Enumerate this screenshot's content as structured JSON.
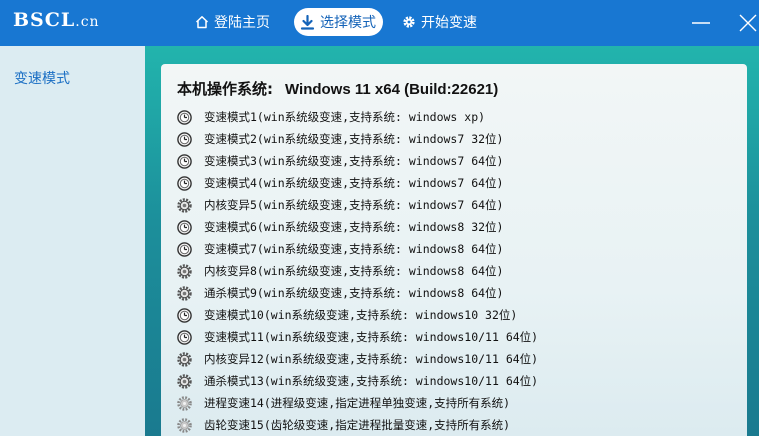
{
  "header": {
    "logo_main": "BSCL",
    "logo_domain": ".cn",
    "nav": [
      {
        "label": "登陆主页",
        "icon": "home-icon"
      },
      {
        "label": "选择模式",
        "icon": "download-arrow-icon",
        "active": true
      },
      {
        "label": "开始变速",
        "icon": "gear-icon"
      }
    ],
    "window_controls": [
      "minimize-icon",
      "close-icon"
    ]
  },
  "sidebar": {
    "items": [
      {
        "label": "变速模式"
      }
    ]
  },
  "main": {
    "os_label": "本机操作系统:",
    "os_value": "Windows 11 x64 (Build:22621)",
    "modes": [
      {
        "icon": "clock-radio-icon",
        "label": "变速模式1(win系统级变速,支持系统: windows xp)"
      },
      {
        "icon": "clock-radio-icon",
        "label": "变速模式2(win系统级变速,支持系统: windows7 32位)"
      },
      {
        "icon": "clock-radio-icon",
        "label": "变速模式3(win系统级变速,支持系统: windows7 64位)"
      },
      {
        "icon": "clock-radio-icon",
        "label": "变速模式4(win系统级变速,支持系统: windows7 64位)"
      },
      {
        "icon": "gear-radio-icon",
        "label": "内核变异5(win系统级变速,支持系统: windows7 64位)"
      },
      {
        "icon": "clock-radio-icon",
        "label": "变速模式6(win系统级变速,支持系统: windows8 32位)"
      },
      {
        "icon": "clock-radio-icon",
        "label": "变速模式7(win系统级变速,支持系统: windows8 64位)"
      },
      {
        "icon": "gear-radio-icon",
        "label": "内核变异8(win系统级变速,支持系统: windows8 64位)"
      },
      {
        "icon": "gear-radio-icon",
        "label": "通杀模式9(win系统级变速,支持系统: windows8 64位)"
      },
      {
        "icon": "clock-radio-icon",
        "label": "变速模式10(win系统级变速,支持系统: windows10 32位)"
      },
      {
        "icon": "clock-radio-icon",
        "label": "变速模式11(win系统级变速,支持系统: windows10/11 64位)"
      },
      {
        "icon": "gear-radio-icon",
        "label": "内核变异12(win系统级变速,支持系统: windows10/11 64位)"
      },
      {
        "icon": "gear-radio-icon",
        "label": "通杀模式13(win系统级变速,支持系统: windows10/11 64位)"
      },
      {
        "icon": "cog-radio-icon",
        "label": "进程变速14(进程级变速,指定进程单独变速,支持所有系统)"
      },
      {
        "icon": "cog-radio-icon",
        "label": "齿轮变速15(齿轮级变速,指定进程批量变速,支持所有系统)"
      }
    ]
  },
  "colors": {
    "topbar": "#1877d2",
    "sidebar_text": "#1b6fc4",
    "band_top": "#22b4ad",
    "band_bottom": "#1a7a8f"
  }
}
